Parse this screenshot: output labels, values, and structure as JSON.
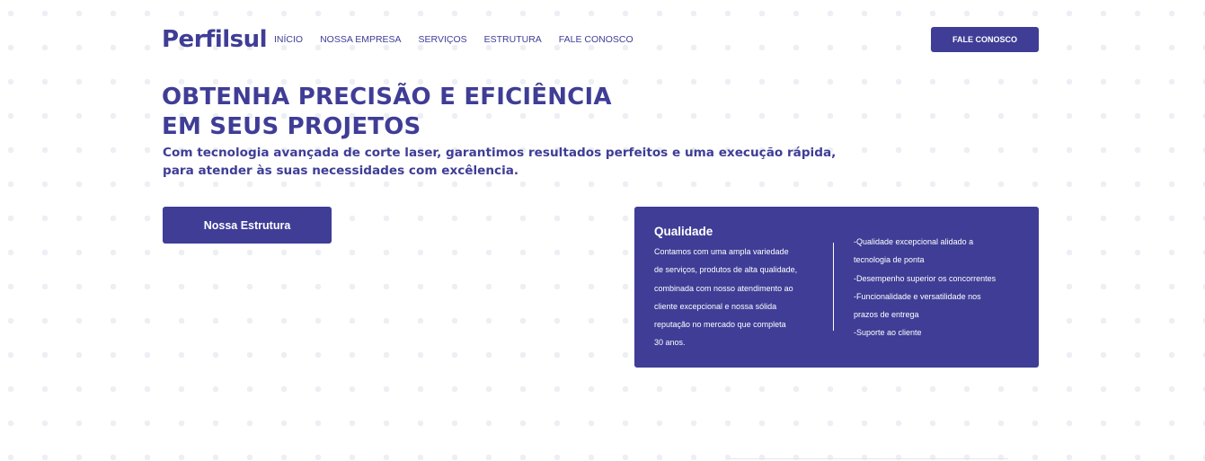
{
  "header": {
    "logo": "Perfilsul",
    "nav": [
      "INÍCIO",
      "NOSSA EMPRESA",
      "SERVIÇOS",
      "ESTRUTURA",
      "FALE CONOSCO"
    ],
    "cta": "FALE CONOSCO"
  },
  "hero": {
    "title_lines": [
      "OBTENHA PRECISÃO E EFICIÊNCIA",
      "EM SEUS PROJETOS"
    ],
    "subtitle_lines": [
      "Com tecnologia avançada de corte laser, garantimos resultados perfeitos e uma execução rápida,",
      "para atender às suas necessidades com excêlencia."
    ],
    "button": "Nossa Estrutura"
  },
  "quality": {
    "title": "Qualidade",
    "description_lines": [
      "Contamos com uma ampla variedade",
      "de serviços, produtos de alta qualidade,",
      "combinada com nosso atendimento ao",
      "cliente excepcional e nossa sólida",
      "reputação no mercado que completa",
      "30 anos."
    ],
    "list_lines": [
      "-Qualidade excepcional alidado a",
      "tecnologia de ponta",
      "-Desempenho superior os concorrentes",
      "-Funcionalidade e versatilidade nos",
      "prazos de entrega",
      "-Suporte ao cliente"
    ]
  },
  "colors": {
    "brand": "#3f3d96",
    "background": "#ffffff",
    "dots": "#eceff3"
  }
}
